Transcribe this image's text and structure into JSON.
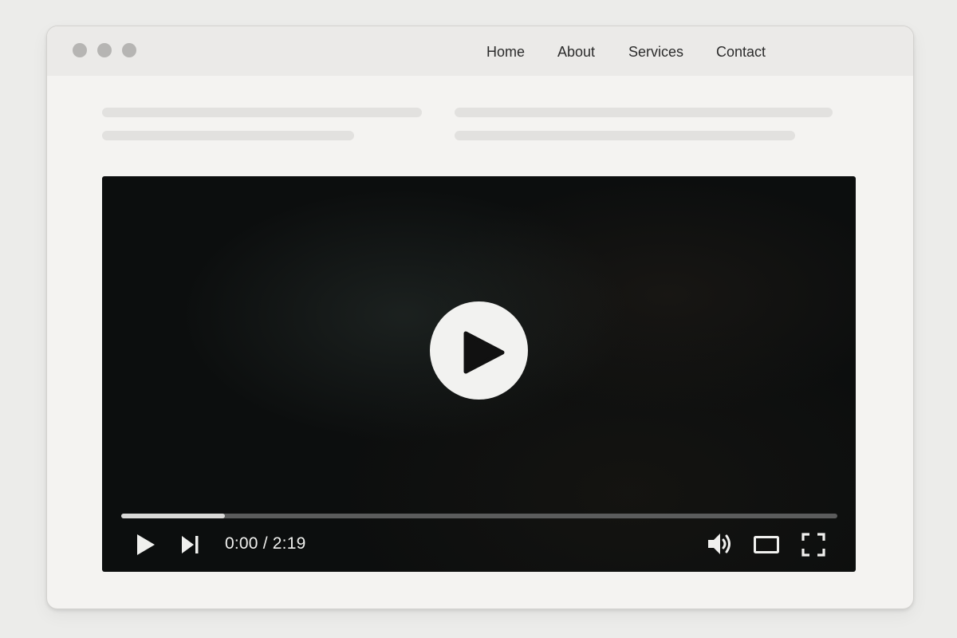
{
  "nav": {
    "items": [
      "Home",
      "About",
      "Services",
      "Contact"
    ]
  },
  "player": {
    "time_display": "0:00 / 2:19",
    "current_time": "0:00",
    "duration": "2:19",
    "progress_fraction": 0.145,
    "state": "paused"
  },
  "icons": {
    "big_play": "play-icon",
    "play": "play-icon",
    "next": "skip-next-icon",
    "volume": "volume-icon",
    "theater": "theater-mode-icon",
    "fullscreen": "fullscreen-icon"
  },
  "colors": {
    "window_bg": "#f4f3f1",
    "titlebar_bg": "#ebeae8",
    "video_bg": "#0c0e0e",
    "progress_fill": "#d9d9d7",
    "progress_track": "#5b5c5c",
    "controls": "#f0f0ee"
  }
}
